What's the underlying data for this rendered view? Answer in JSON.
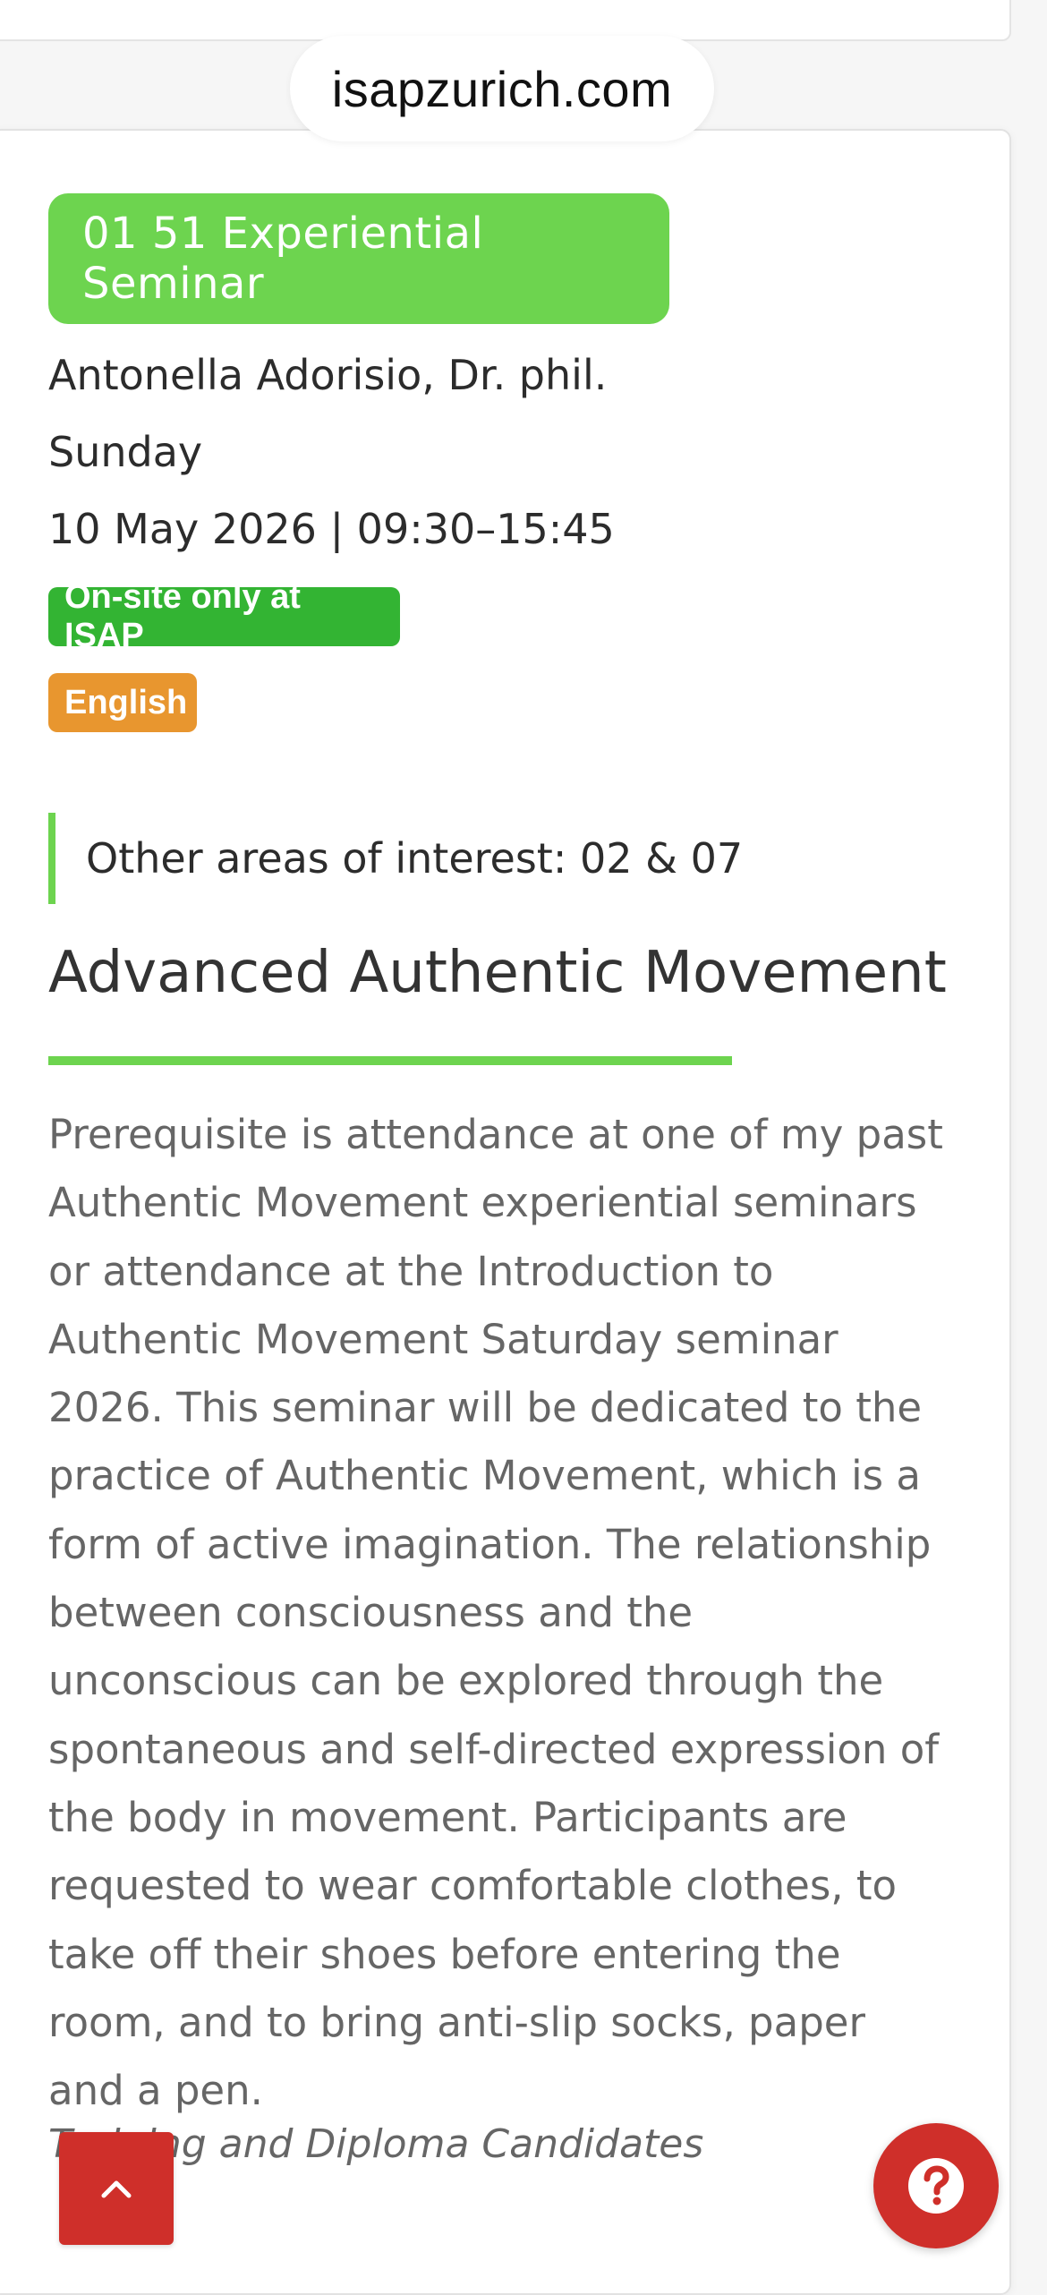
{
  "browser": {
    "url": "isapzurich.com"
  },
  "event": {
    "category": "01 51 Experiential Seminar",
    "instructor": "Antonella Adorisio, Dr. phil.",
    "day": "Sunday",
    "datetime": "10 May 2026 | 09:30–15:45",
    "location_badge": "On-site only at ISAP",
    "language_badge": "English",
    "other_interests": "Other areas of interest: 02 & 07",
    "title": "Advanced Authentic Movement",
    "description": "Prerequisite is attendance at one of my past Authentic Movement experiential seminars or attendance at the Introduction to Authentic Movement Saturday seminar 2026. This seminar will be dedicated to the practice of Authentic Movement, which is a form of active imagination. The relationship between consciousness and the unconscious can be explored through the spontaneous and self-directed expression of the body in movement. Participants are requested to wear comfortable clothes, to take off their shoes before entering the room, and to bring anti-slip socks, paper and a pen.",
    "audience": "Training and Diploma Candidates"
  },
  "icons": {
    "scroll_top": "chevron-up-icon",
    "help": "question-circle-icon"
  },
  "colors": {
    "accent_green": "#6dd44f",
    "onsite_green": "#33b433",
    "language_orange": "#e8962f",
    "button_red": "#cf2f2a"
  }
}
